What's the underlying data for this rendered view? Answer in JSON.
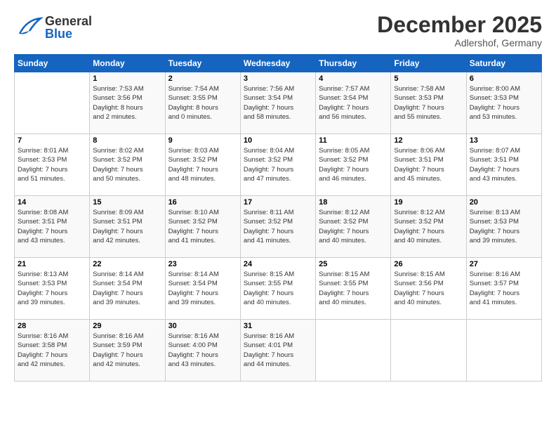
{
  "header": {
    "logo_general": "General",
    "logo_blue": "Blue",
    "month": "December 2025",
    "location": "Adlershof, Germany"
  },
  "weekdays": [
    "Sunday",
    "Monday",
    "Tuesday",
    "Wednesday",
    "Thursday",
    "Friday",
    "Saturday"
  ],
  "weeks": [
    [
      {
        "day": "",
        "info": ""
      },
      {
        "day": "1",
        "info": "Sunrise: 7:53 AM\nSunset: 3:56 PM\nDaylight: 8 hours\nand 2 minutes."
      },
      {
        "day": "2",
        "info": "Sunrise: 7:54 AM\nSunset: 3:55 PM\nDaylight: 8 hours\nand 0 minutes."
      },
      {
        "day": "3",
        "info": "Sunrise: 7:56 AM\nSunset: 3:54 PM\nDaylight: 7 hours\nand 58 minutes."
      },
      {
        "day": "4",
        "info": "Sunrise: 7:57 AM\nSunset: 3:54 PM\nDaylight: 7 hours\nand 56 minutes."
      },
      {
        "day": "5",
        "info": "Sunrise: 7:58 AM\nSunset: 3:53 PM\nDaylight: 7 hours\nand 55 minutes."
      },
      {
        "day": "6",
        "info": "Sunrise: 8:00 AM\nSunset: 3:53 PM\nDaylight: 7 hours\nand 53 minutes."
      }
    ],
    [
      {
        "day": "7",
        "info": "Sunrise: 8:01 AM\nSunset: 3:53 PM\nDaylight: 7 hours\nand 51 minutes."
      },
      {
        "day": "8",
        "info": "Sunrise: 8:02 AM\nSunset: 3:52 PM\nDaylight: 7 hours\nand 50 minutes."
      },
      {
        "day": "9",
        "info": "Sunrise: 8:03 AM\nSunset: 3:52 PM\nDaylight: 7 hours\nand 48 minutes."
      },
      {
        "day": "10",
        "info": "Sunrise: 8:04 AM\nSunset: 3:52 PM\nDaylight: 7 hours\nand 47 minutes."
      },
      {
        "day": "11",
        "info": "Sunrise: 8:05 AM\nSunset: 3:52 PM\nDaylight: 7 hours\nand 46 minutes."
      },
      {
        "day": "12",
        "info": "Sunrise: 8:06 AM\nSunset: 3:51 PM\nDaylight: 7 hours\nand 45 minutes."
      },
      {
        "day": "13",
        "info": "Sunrise: 8:07 AM\nSunset: 3:51 PM\nDaylight: 7 hours\nand 43 minutes."
      }
    ],
    [
      {
        "day": "14",
        "info": "Sunrise: 8:08 AM\nSunset: 3:51 PM\nDaylight: 7 hours\nand 43 minutes."
      },
      {
        "day": "15",
        "info": "Sunrise: 8:09 AM\nSunset: 3:51 PM\nDaylight: 7 hours\nand 42 minutes."
      },
      {
        "day": "16",
        "info": "Sunrise: 8:10 AM\nSunset: 3:52 PM\nDaylight: 7 hours\nand 41 minutes."
      },
      {
        "day": "17",
        "info": "Sunrise: 8:11 AM\nSunset: 3:52 PM\nDaylight: 7 hours\nand 41 minutes."
      },
      {
        "day": "18",
        "info": "Sunrise: 8:12 AM\nSunset: 3:52 PM\nDaylight: 7 hours\nand 40 minutes."
      },
      {
        "day": "19",
        "info": "Sunrise: 8:12 AM\nSunset: 3:52 PM\nDaylight: 7 hours\nand 40 minutes."
      },
      {
        "day": "20",
        "info": "Sunrise: 8:13 AM\nSunset: 3:53 PM\nDaylight: 7 hours\nand 39 minutes."
      }
    ],
    [
      {
        "day": "21",
        "info": "Sunrise: 8:13 AM\nSunset: 3:53 PM\nDaylight: 7 hours\nand 39 minutes."
      },
      {
        "day": "22",
        "info": "Sunrise: 8:14 AM\nSunset: 3:54 PM\nDaylight: 7 hours\nand 39 minutes."
      },
      {
        "day": "23",
        "info": "Sunrise: 8:14 AM\nSunset: 3:54 PM\nDaylight: 7 hours\nand 39 minutes."
      },
      {
        "day": "24",
        "info": "Sunrise: 8:15 AM\nSunset: 3:55 PM\nDaylight: 7 hours\nand 40 minutes."
      },
      {
        "day": "25",
        "info": "Sunrise: 8:15 AM\nSunset: 3:55 PM\nDaylight: 7 hours\nand 40 minutes."
      },
      {
        "day": "26",
        "info": "Sunrise: 8:15 AM\nSunset: 3:56 PM\nDaylight: 7 hours\nand 40 minutes."
      },
      {
        "day": "27",
        "info": "Sunrise: 8:16 AM\nSunset: 3:57 PM\nDaylight: 7 hours\nand 41 minutes."
      }
    ],
    [
      {
        "day": "28",
        "info": "Sunrise: 8:16 AM\nSunset: 3:58 PM\nDaylight: 7 hours\nand 42 minutes."
      },
      {
        "day": "29",
        "info": "Sunrise: 8:16 AM\nSunset: 3:59 PM\nDaylight: 7 hours\nand 42 minutes."
      },
      {
        "day": "30",
        "info": "Sunrise: 8:16 AM\nSunset: 4:00 PM\nDaylight: 7 hours\nand 43 minutes."
      },
      {
        "day": "31",
        "info": "Sunrise: 8:16 AM\nSunset: 4:01 PM\nDaylight: 7 hours\nand 44 minutes."
      },
      {
        "day": "",
        "info": ""
      },
      {
        "day": "",
        "info": ""
      },
      {
        "day": "",
        "info": ""
      }
    ]
  ]
}
